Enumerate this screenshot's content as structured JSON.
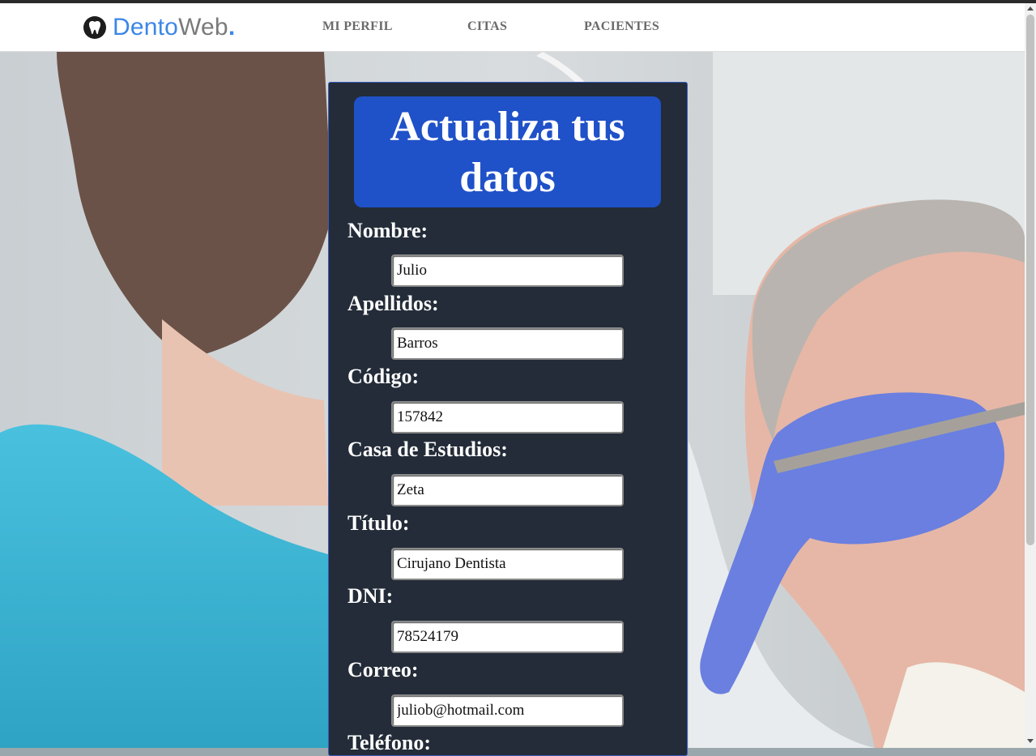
{
  "brand": {
    "name_part1": "Dento",
    "name_part2": "Web",
    "name_dot": "."
  },
  "nav": {
    "items": [
      {
        "label": "MI PERFIL"
      },
      {
        "label": "CITAS"
      },
      {
        "label": "PACIENTES"
      }
    ]
  },
  "form": {
    "title": "Actualiza tus datos",
    "fields": [
      {
        "label": "Nombre:",
        "value": "Julio"
      },
      {
        "label": "Apellidos:",
        "value": "Barros"
      },
      {
        "label": "Código:",
        "value": "157842"
      },
      {
        "label": "Casa de Estudios:",
        "value": "Zeta"
      },
      {
        "label": "Título:",
        "value": "Cirujano Dentista"
      },
      {
        "label": "DNI:",
        "value": "78524179"
      },
      {
        "label": "Correo:",
        "value": "juliob@hotmail.com"
      },
      {
        "label": "Teléfono:",
        "value": ""
      }
    ]
  },
  "colors": {
    "brand_blue": "#3b86e8",
    "title_bg": "#1f51c8",
    "card_bg": "#232c38"
  },
  "icons": {
    "logo": "tooth-icon"
  }
}
